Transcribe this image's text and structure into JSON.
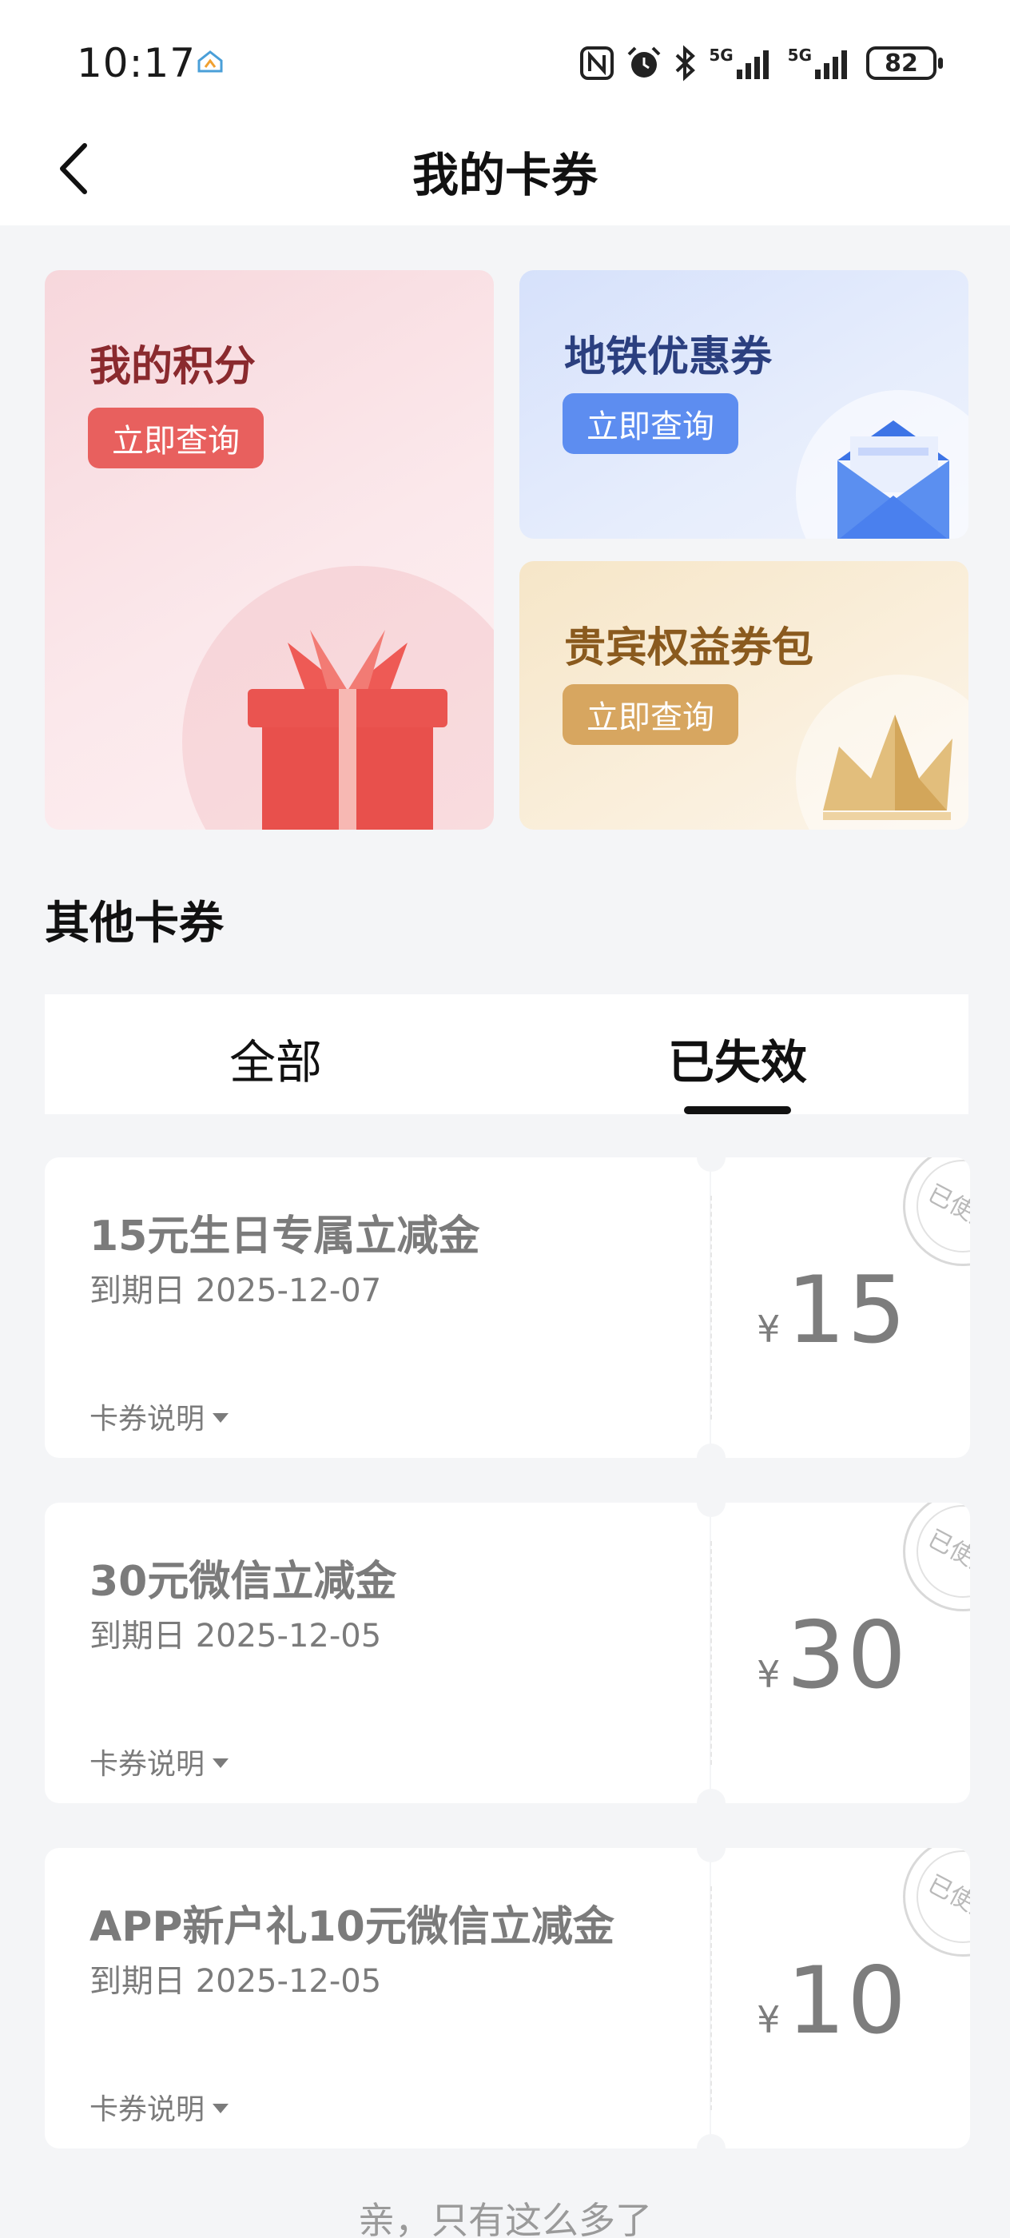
{
  "status_bar": {
    "time": "10:17",
    "battery": "82",
    "signal_1": "5G",
    "signal_2": "5G",
    "icons": [
      "app-home-icon",
      "nfc-icon",
      "alarm-icon",
      "bluetooth-icon",
      "signal-5g-icon",
      "signal-5g-icon",
      "battery-icon"
    ]
  },
  "header": {
    "title": "我的卡券",
    "back_icon": "chevron-left-icon"
  },
  "feature_cards": [
    {
      "title": "我的积分",
      "button": "立即查询",
      "icon": "gift-icon",
      "color": "#e8605e"
    },
    {
      "title": "地铁优惠券",
      "button": "立即查询",
      "icon": "envelope-icon",
      "color": "#5d8df0"
    },
    {
      "title": "贵宾权益券包",
      "button": "立即查询",
      "icon": "crown-icon",
      "color": "#d7a660"
    }
  ],
  "section": {
    "title": "其他卡券"
  },
  "tabs": [
    {
      "label": "全部",
      "active": false
    },
    {
      "label": "已失效",
      "active": true
    }
  ],
  "coupons": [
    {
      "name": "15元生日专属立减金",
      "expiry": "到期日 2025-12-07",
      "description_label": "卡券说明",
      "currency": "¥",
      "amount": "15",
      "stamp": "已使用"
    },
    {
      "name": "30元微信立减金",
      "expiry": "到期日 2025-12-05",
      "description_label": "卡券说明",
      "currency": "¥",
      "amount": "30",
      "stamp": "已使用"
    },
    {
      "name": "APP新户礼10元微信立减金",
      "expiry": "到期日 2025-12-05",
      "description_label": "卡券说明",
      "currency": "¥",
      "amount": "10",
      "stamp": "已使用"
    }
  ],
  "footer": {
    "note": "亲，只有这么多了"
  }
}
